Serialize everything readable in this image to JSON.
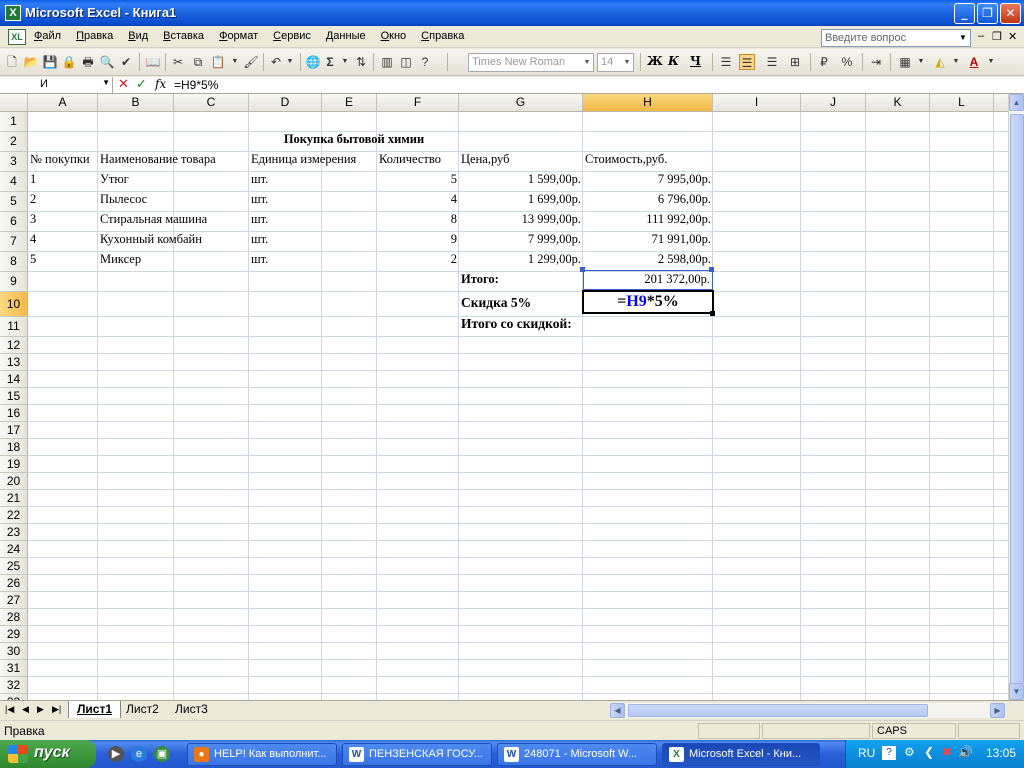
{
  "window": {
    "title": "Microsoft Excel - Книга1",
    "min": "_",
    "max": "❐",
    "close": "✕"
  },
  "menu": {
    "items": [
      "Файл",
      "Правка",
      "Вид",
      "Вставка",
      "Формат",
      "Сервис",
      "Данные",
      "Окно",
      "Справка"
    ],
    "help_placeholder": "Введите вопрос",
    "mdi_min": "–",
    "mdi_restore": "❐",
    "mdi_close": "✕"
  },
  "toolbar": {
    "font_name": "Times New Roman",
    "font_size": "14",
    "bold": "Ж",
    "italic": "К",
    "underline": "Ч",
    "autosum": "Σ",
    "percent": "%"
  },
  "formula_bar": {
    "name_box": "И",
    "cancel": "✕",
    "enter": "✓",
    "fx": "fx",
    "formula": "=H9*5%"
  },
  "sheet": {
    "columns": [
      "A",
      "B",
      "C",
      "D",
      "E",
      "F",
      "G",
      "H",
      "I",
      "J",
      "K",
      "L"
    ],
    "selected_column": "H",
    "selected_row": "10",
    "title": "Покупка бытовой химии",
    "headers": {
      "a": "№ покупки",
      "b": "Наименование товара",
      "d": "Единица измерения",
      "f": "Количество",
      "g": "Цена,руб",
      "h": "Стоимость,руб."
    },
    "rows": [
      {
        "a": "1",
        "b": "Утюг",
        "d": "шт.",
        "f": "5",
        "g": "1 599,00р.",
        "h": "7 995,00р."
      },
      {
        "a": "2",
        "b": "Пылесос",
        "d": "шт.",
        "f": "4",
        "g": "1 699,00р.",
        "h": "6 796,00р."
      },
      {
        "a": "3",
        "b": "Стиральная машина",
        "d": "шт.",
        "f": "8",
        "g": "13 999,00р.",
        "h": "111 992,00р."
      },
      {
        "a": "4",
        "b": "Кухонный комбайн",
        "d": "шт.",
        "f": "9",
        "g": "7 999,00р.",
        "h": "71 991,00р."
      },
      {
        "a": "5",
        "b": "Миксер",
        "d": "шт.",
        "f": "2",
        "g": "1 299,00р.",
        "h": "2 598,00р."
      }
    ],
    "total_label": "Итого:",
    "total_value": "201 372,00р.",
    "discount_label": "Скидка 5%",
    "discount_ref": "H9",
    "discount_rest": "*5%",
    "discount_eq": "=",
    "total_discount_label": "Итого со скидкой:",
    "row_count": 33
  },
  "tabs": {
    "items": [
      "Лист1",
      "Лист2",
      "Лист3"
    ],
    "active": "Лист1"
  },
  "status": {
    "mode": "Правка",
    "caps": "CAPS"
  },
  "taskbar": {
    "start": "пуск",
    "tasks": [
      "HELP! Как выполнит...",
      "ПЕНЗЕНСКАЯ ГОСУ...",
      "248071 - Microsoft W...",
      "Microsoft Excel - Кни..."
    ],
    "lang": "RU",
    "clock": "13:05"
  },
  "colors": {
    "accent": "#0a5fe8",
    "selection": "#f3b847",
    "formula_ref": "#0000ff"
  }
}
